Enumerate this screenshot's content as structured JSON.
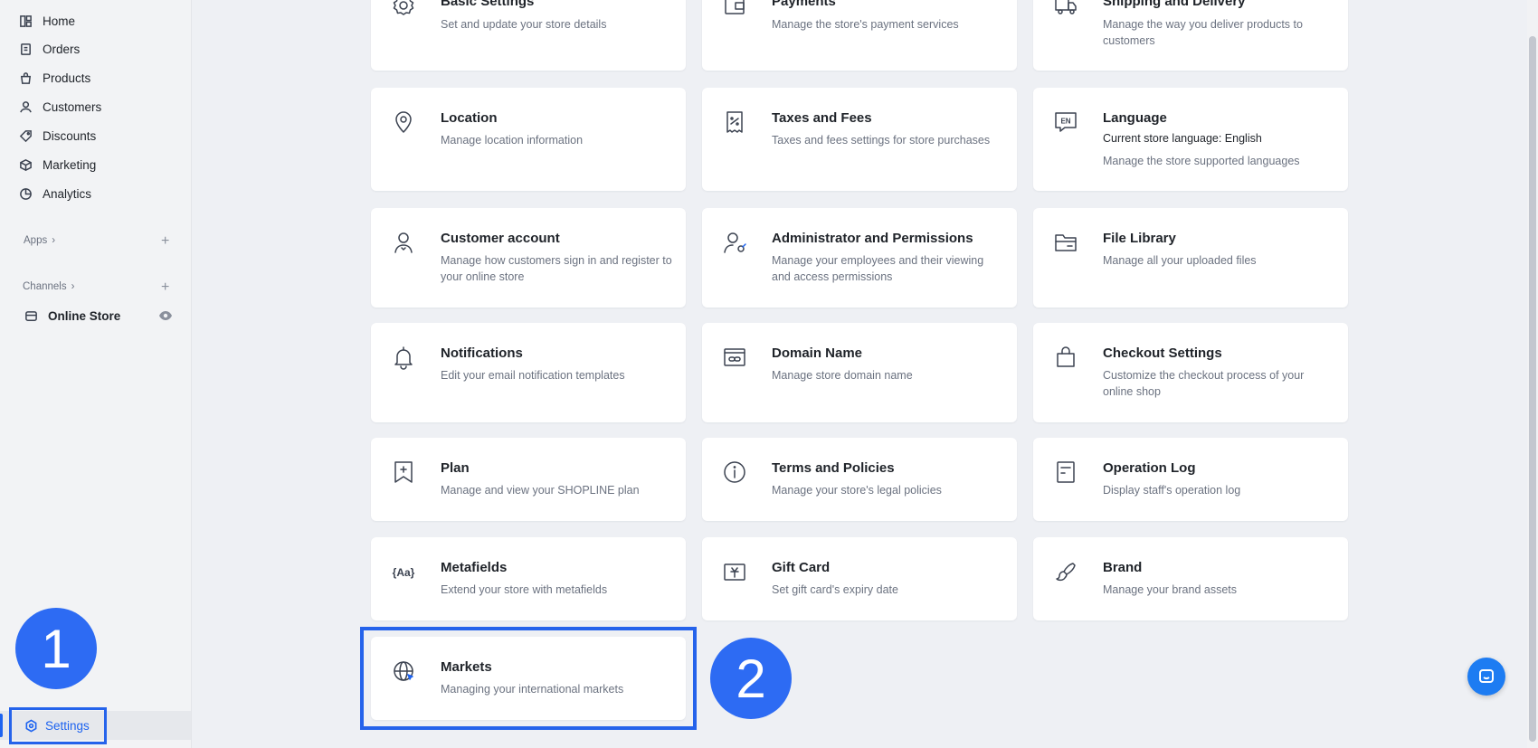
{
  "sidebar": {
    "items": [
      {
        "label": "Home",
        "icon": "home-icon"
      },
      {
        "label": "Orders",
        "icon": "orders-icon"
      },
      {
        "label": "Products",
        "icon": "products-icon"
      },
      {
        "label": "Customers",
        "icon": "customers-icon"
      },
      {
        "label": "Discounts",
        "icon": "discounts-icon"
      },
      {
        "label": "Marketing",
        "icon": "marketing-icon"
      },
      {
        "label": "Analytics",
        "icon": "analytics-icon"
      }
    ],
    "apps_label": "Apps",
    "channels_label": "Channels",
    "online_store_label": "Online Store",
    "settings_label": "Settings"
  },
  "cards": [
    {
      "title": "Basic Settings",
      "desc": "Set and update your store details",
      "icon": "gear-icon"
    },
    {
      "title": "Payments",
      "desc": "Manage the store's payment services",
      "icon": "wallet-icon"
    },
    {
      "title": "Shipping and Delivery",
      "desc": "Manage the way you deliver products to customers",
      "icon": "truck-icon"
    },
    {
      "title": "Location",
      "desc": "Manage location information",
      "icon": "location-pin-icon"
    },
    {
      "title": "Taxes and Fees",
      "desc": "Taxes and fees settings for store purchases",
      "icon": "receipt-icon"
    },
    {
      "title": "Language",
      "extra": "Current store language: English",
      "desc": "Manage the store supported languages",
      "icon": "language-en-icon",
      "icon_text": "EN"
    },
    {
      "title": "Customer account",
      "desc": "Manage how customers sign in and register to your online store",
      "icon": "customer-account-icon"
    },
    {
      "title": "Administrator and Permissions",
      "desc": "Manage your employees and their viewing and access permissions",
      "icon": "admin-permissions-icon"
    },
    {
      "title": "File Library",
      "desc": "Manage all your uploaded files",
      "icon": "folder-icon"
    },
    {
      "title": "Notifications",
      "desc": "Edit your email notification templates",
      "icon": "bell-icon"
    },
    {
      "title": "Domain Name",
      "desc": "Manage store domain name",
      "icon": "domain-link-icon"
    },
    {
      "title": "Checkout Settings",
      "desc": "Customize the checkout process of your online shop",
      "icon": "shopping-bag-icon"
    },
    {
      "title": "Plan",
      "desc": "Manage and view your SHOPLINE plan",
      "icon": "plan-bookmark-icon"
    },
    {
      "title": "Terms and Policies",
      "desc": "Manage your store's legal policies",
      "icon": "info-icon"
    },
    {
      "title": "Operation Log",
      "desc": "Display staff's operation log",
      "icon": "log-icon"
    },
    {
      "title": "Metafields",
      "desc": "Extend your store with metafields",
      "icon": "metafields-icon",
      "icon_text": "{Aa}"
    },
    {
      "title": "Gift Card",
      "desc": "Set gift card's expiry date",
      "icon": "gift-card-icon"
    },
    {
      "title": "Brand",
      "desc": "Manage your brand assets",
      "icon": "brand-brush-icon"
    },
    {
      "title": "Markets",
      "desc": "Managing your international markets",
      "icon": "globe-icon"
    }
  ],
  "annotations": {
    "step1": "1",
    "step2": "2"
  },
  "colors": {
    "accent": "#1d63f0",
    "badge": "#2d6bf3",
    "background": "#eef0f4"
  }
}
